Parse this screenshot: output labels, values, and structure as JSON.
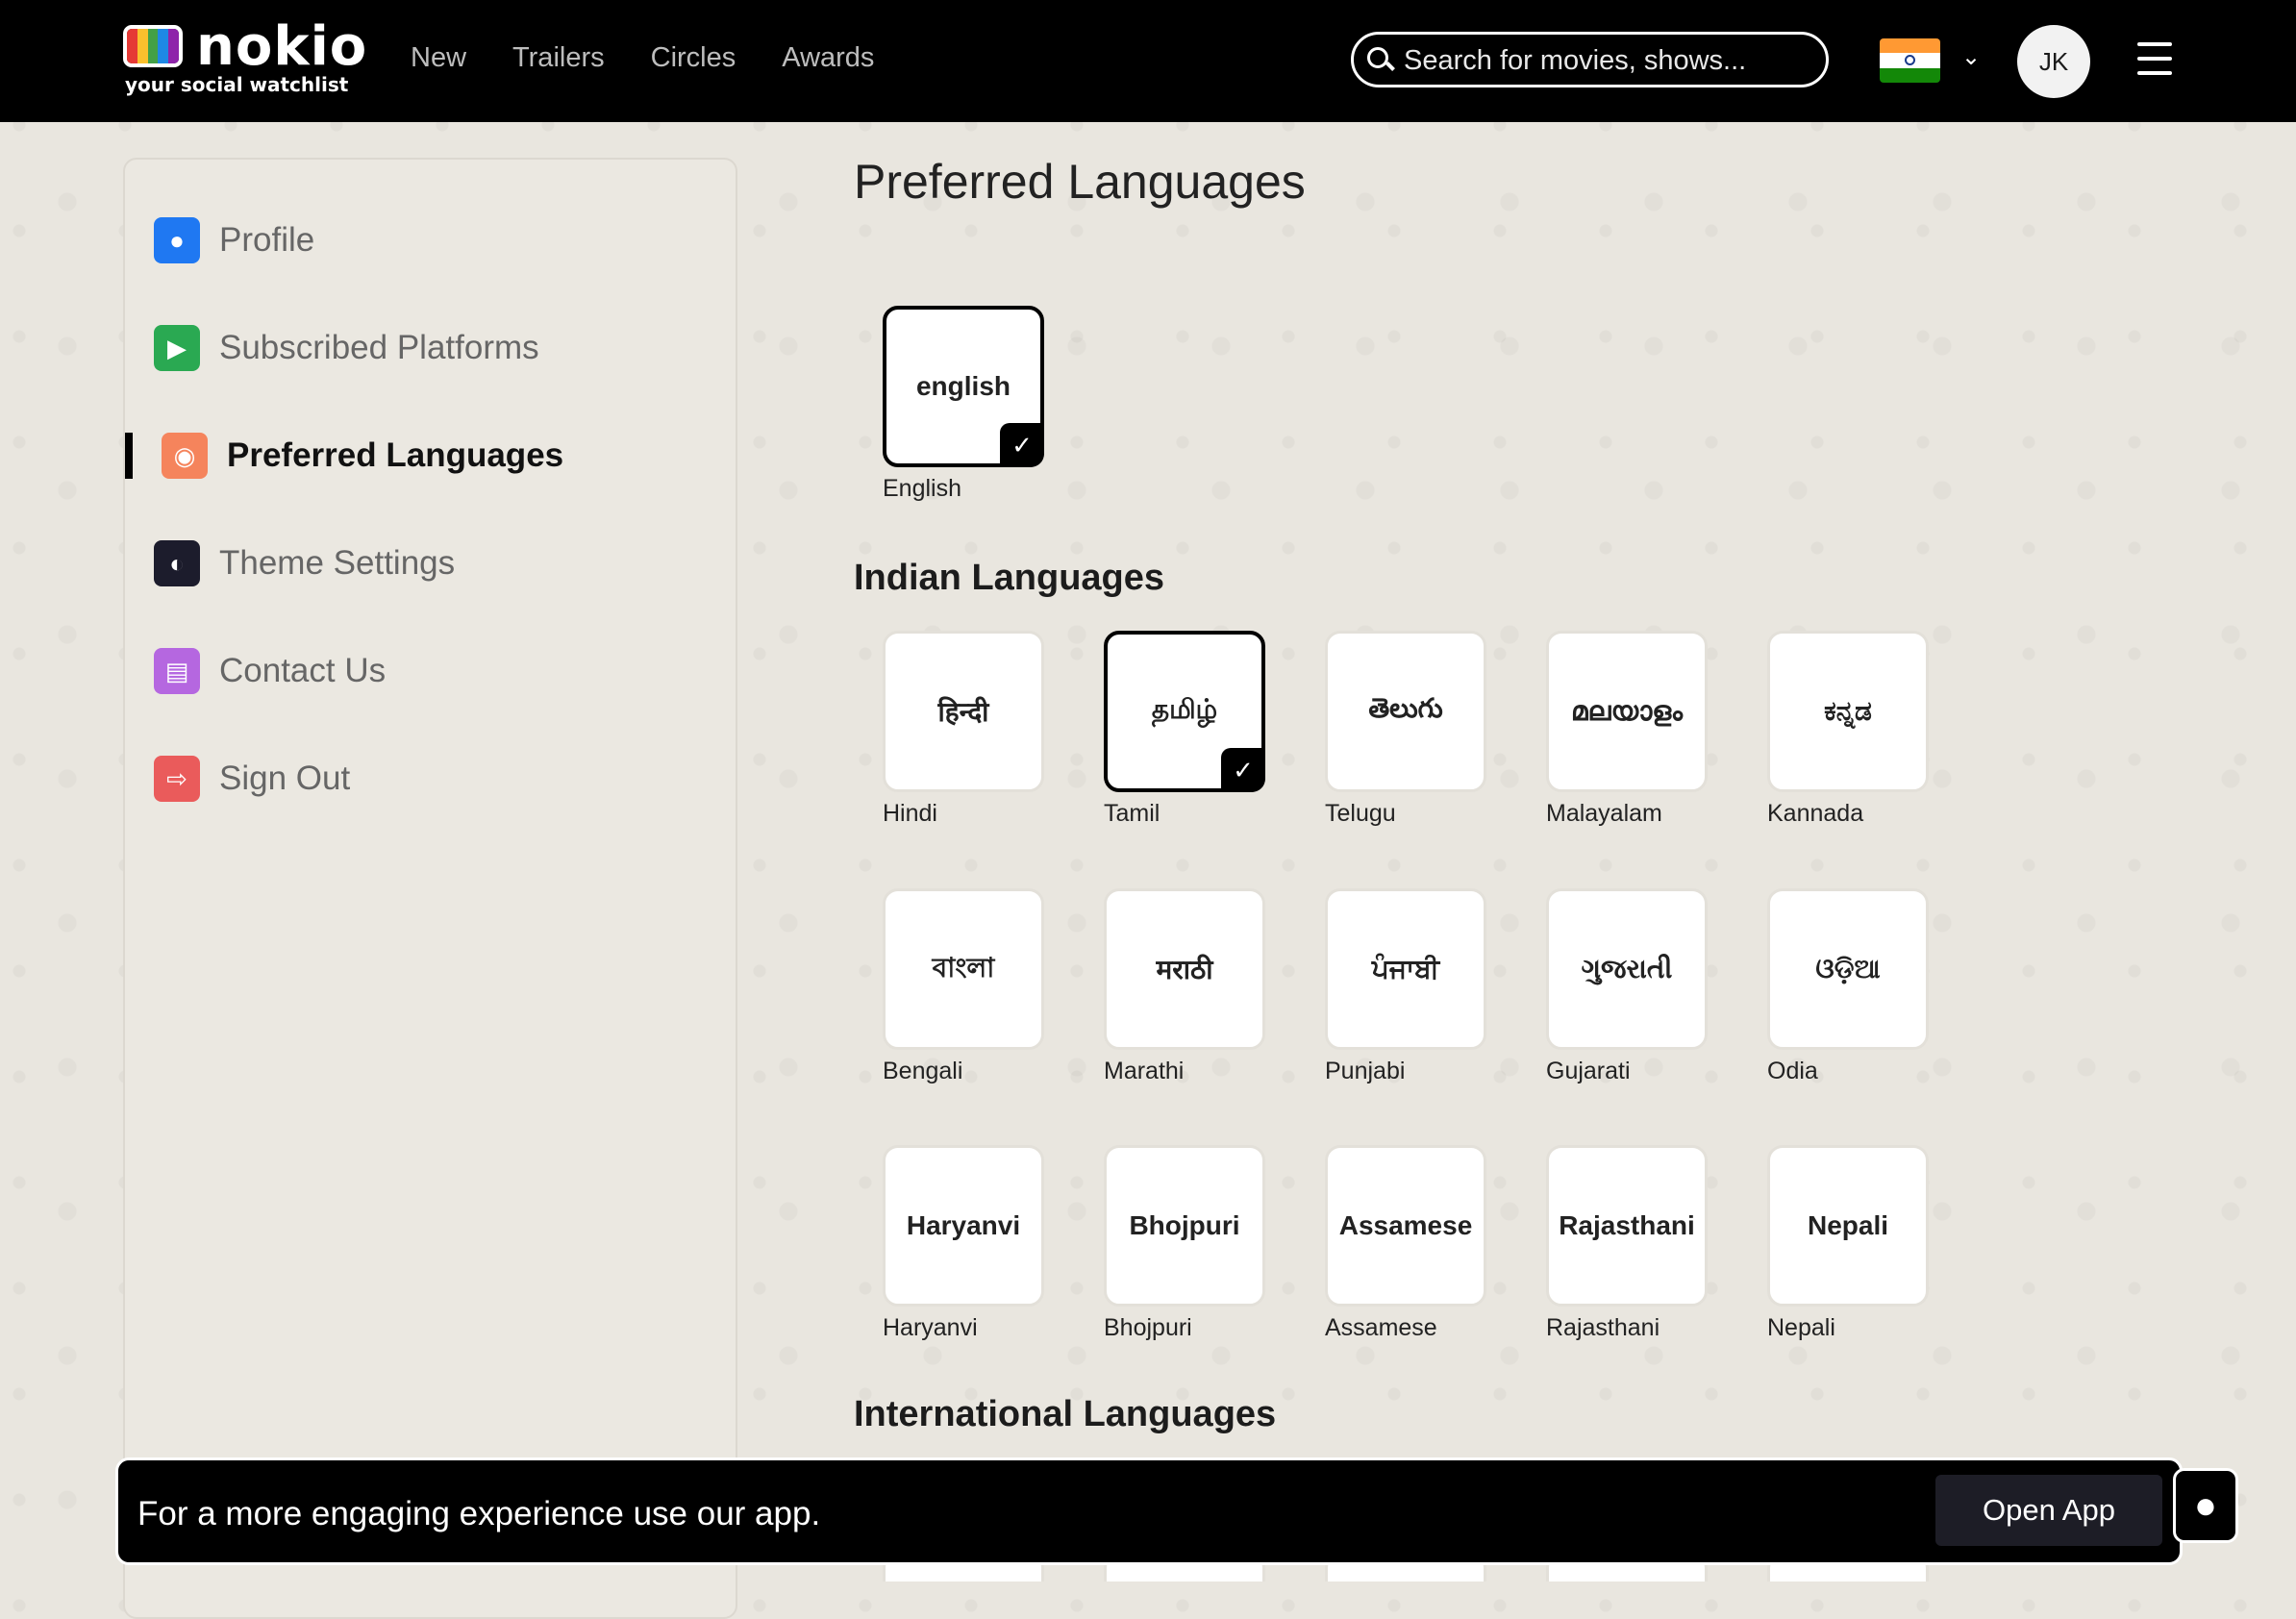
{
  "header": {
    "logo_word": "nokio",
    "logo_tagline": "your social watchlist",
    "nav": [
      "New",
      "Trailers",
      "Circles",
      "Awards"
    ],
    "search_placeholder": "Search for movies, shows...",
    "avatar_initials": "JK"
  },
  "sidebar": {
    "items": [
      {
        "label": "Profile",
        "icon": "person-icon",
        "color": "#1f78f2"
      },
      {
        "label": "Subscribed Platforms",
        "icon": "tv-icon",
        "color": "#2aa952"
      },
      {
        "label": "Preferred Languages",
        "icon": "language-icon",
        "color": "#f5845c",
        "active": true
      },
      {
        "label": "Theme Settings",
        "icon": "theme-icon",
        "color": "#1c1c2c"
      },
      {
        "label": "Contact Us",
        "icon": "chat-icon",
        "color": "#b567e0"
      },
      {
        "label": "Sign Out",
        "icon": "sign-out-icon",
        "color": "#ea5b5b"
      }
    ]
  },
  "main": {
    "title": "Preferred Languages",
    "english": {
      "script": "english",
      "label": "English",
      "selected": true
    },
    "indian_title": "Indian Languages",
    "indian": [
      {
        "script": "हिन्दी",
        "label": "Hindi",
        "selected": false
      },
      {
        "script": "தமிழ்",
        "label": "Tamil",
        "selected": true
      },
      {
        "script": "తెలుగు",
        "label": "Telugu",
        "selected": false
      },
      {
        "script": "മലയാളം",
        "label": "Malayalam",
        "selected": false
      },
      {
        "script": "ಕನ್ನಡ",
        "label": "Kannada",
        "selected": false
      },
      {
        "script": "বাংলা",
        "label": "Bengali",
        "selected": false
      },
      {
        "script": "मराठी",
        "label": "Marathi",
        "selected": false
      },
      {
        "script": "ਪੰਜਾਬੀ",
        "label": "Punjabi",
        "selected": false
      },
      {
        "script": "ગુજરાતી",
        "label": "Gujarati",
        "selected": false
      },
      {
        "script": "ଓଡ଼ିଆ",
        "label": "Odia",
        "selected": false
      },
      {
        "script": "Haryanvi",
        "label": "Haryanvi",
        "selected": false
      },
      {
        "script": "Bhojpuri",
        "label": "Bhojpuri",
        "selected": false
      },
      {
        "script": "Assamese",
        "label": "Assamese",
        "selected": false
      },
      {
        "script": "Rajasthani",
        "label": "Rajasthani",
        "selected": false
      },
      {
        "script": "Nepali",
        "label": "Nepali",
        "selected": false
      }
    ],
    "international_title": "International Languages"
  },
  "banner": {
    "message": "For a more engaging experience use our app.",
    "button": "Open App"
  },
  "colors": {
    "accent": "#000000",
    "background": "#e9e6df"
  }
}
